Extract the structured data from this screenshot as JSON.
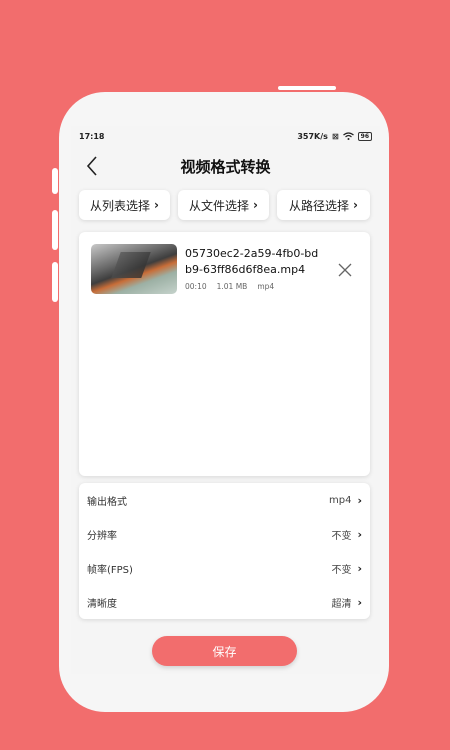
{
  "colors": {
    "background": "#f26d6d",
    "accent": "#f26d6d"
  },
  "statusbar": {
    "time": "17:18",
    "speed": "357K/s",
    "battery": "96"
  },
  "header": {
    "title": "视频格式转换"
  },
  "sources": [
    {
      "label": "从列表选择"
    },
    {
      "label": "从文件选择"
    },
    {
      "label": "从路径选择"
    }
  ],
  "file": {
    "name": "05730ec2-2a59-4fb0-bdb9-63ff86d6f8ea.mp4",
    "duration": "00:10",
    "size": "1.01 MB",
    "format": "mp4"
  },
  "settings": [
    {
      "label": "输出格式",
      "value": "mp4"
    },
    {
      "label": "分辨率",
      "value": "不变"
    },
    {
      "label": "帧率(FPS)",
      "value": "不变"
    },
    {
      "label": "清晰度",
      "value": "超清"
    }
  ],
  "save_label": "保存"
}
